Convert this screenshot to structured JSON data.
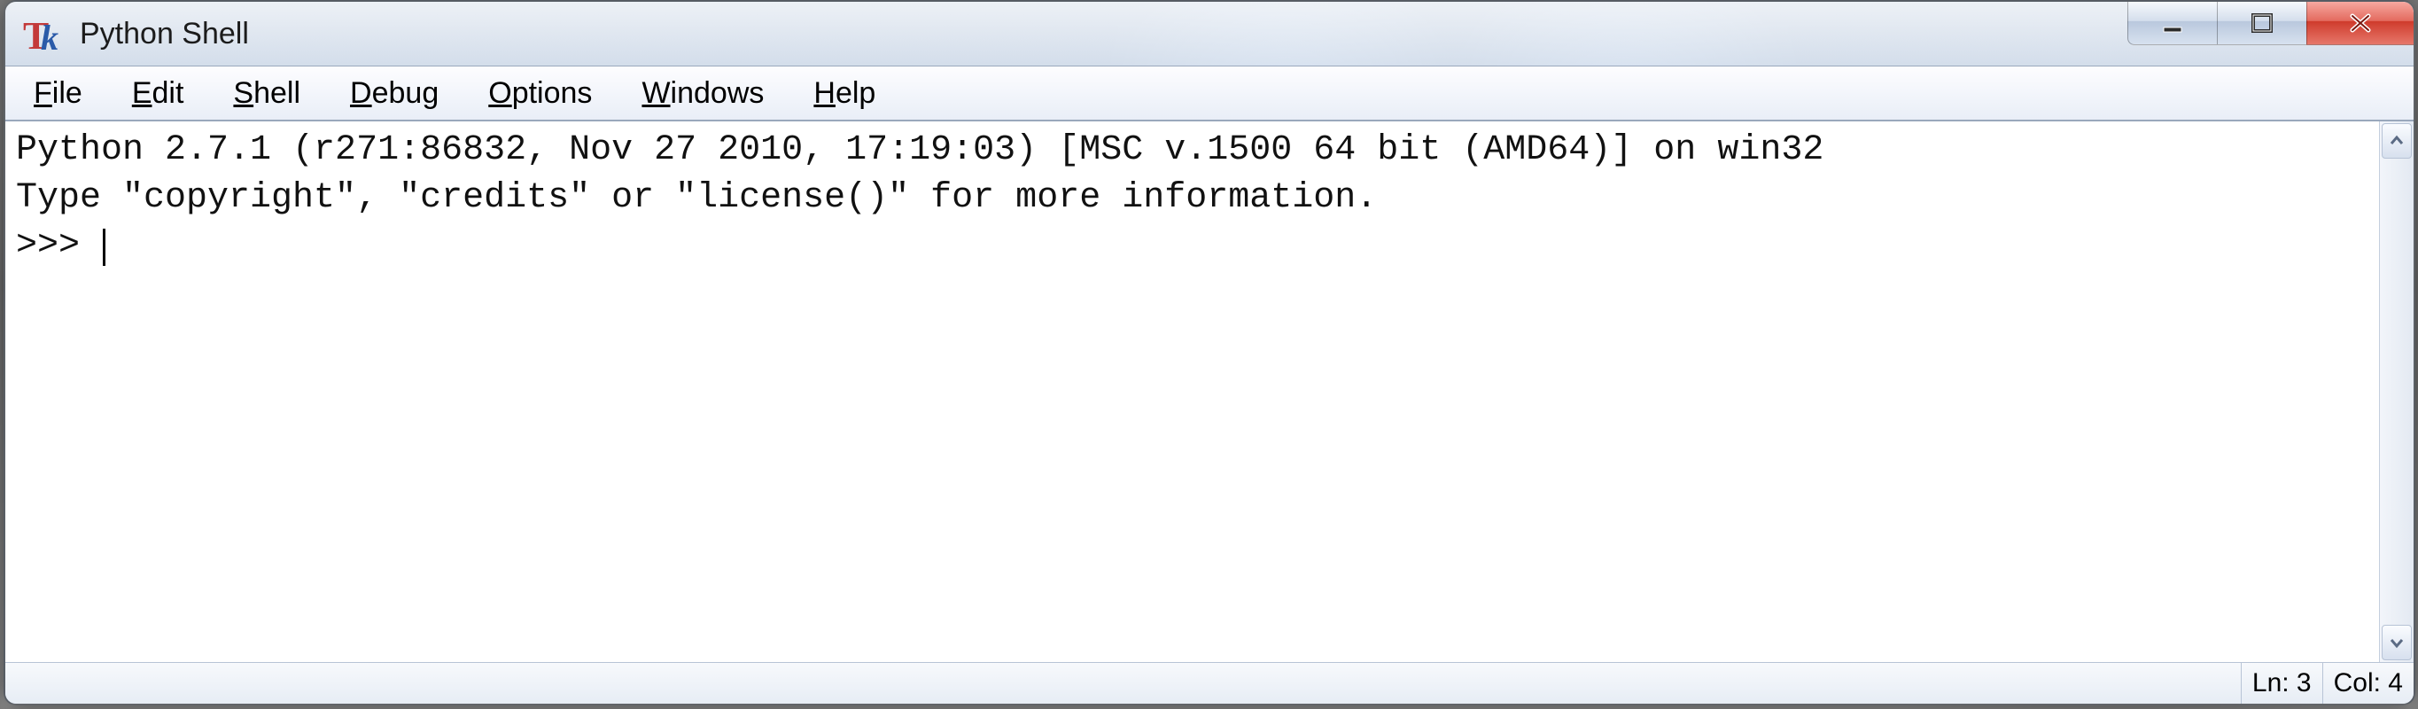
{
  "title": "Python Shell",
  "menu": {
    "file": {
      "label": "File",
      "accel_index": 0
    },
    "edit": {
      "label": "Edit",
      "accel_index": 0
    },
    "shell": {
      "label": "Shell",
      "accel_index": 0
    },
    "debug": {
      "label": "Debug",
      "accel_index": 0
    },
    "options": {
      "label": "Options",
      "accel_index": 0
    },
    "windows": {
      "label": "Windows",
      "accel_index": 0
    },
    "help": {
      "label": "Help",
      "accel_index": 0
    }
  },
  "shell": {
    "banner_line1": "Python 2.7.1 (r271:86832, Nov 27 2010, 17:19:03) [MSC v.1500 64 bit (AMD64)] on win32",
    "banner_line2": "Type \"copyright\", \"credits\" or \"license()\" for more information.",
    "prompt": ">>> "
  },
  "status": {
    "line_label": "Ln: 3",
    "col_label": "Col: 4"
  }
}
